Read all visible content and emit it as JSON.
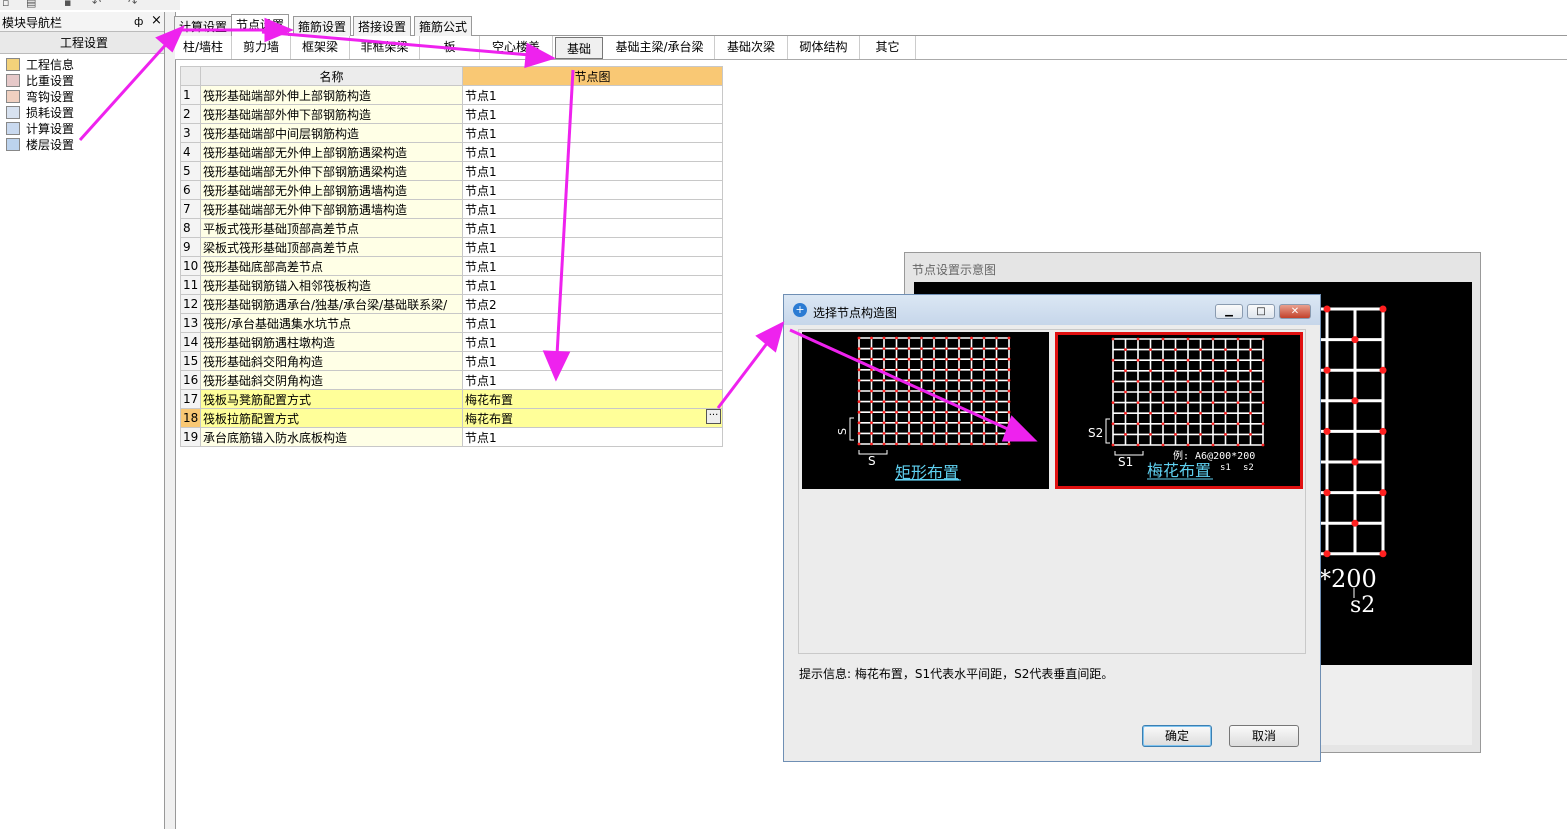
{
  "nav": {
    "title": "模块导航栏",
    "pin_glyph": "ф",
    "close_glyph": "×",
    "header": "工程设置",
    "items": [
      {
        "label": "工程信息",
        "icon": "project-info-icon"
      },
      {
        "label": "比重设置",
        "icon": "density-icon"
      },
      {
        "label": "弯钩设置",
        "icon": "hook-icon"
      },
      {
        "label": "损耗设置",
        "icon": "loss-icon"
      },
      {
        "label": "计算设置",
        "icon": "calc-icon"
      },
      {
        "label": "楼层设置",
        "icon": "floor-icon"
      }
    ]
  },
  "tabs": [
    "计算设置",
    "节点设置",
    "箍筋设置",
    "搭接设置",
    "箍筋公式"
  ],
  "subtabs": [
    "柱/墙柱",
    "剪力墙",
    "框架梁",
    "非框架梁",
    "板",
    "空心楼盖",
    "基础",
    "基础主梁/承台梁",
    "基础次梁",
    "砌体结构",
    "其它"
  ],
  "table": {
    "headers": [
      "名称",
      "节点图"
    ],
    "rows": [
      {
        "n": "1",
        "name": "筏形基础端部外伸上部钢筋构造",
        "value": "节点1"
      },
      {
        "n": "2",
        "name": "筏形基础端部外伸下部钢筋构造",
        "value": "节点1"
      },
      {
        "n": "3",
        "name": "筏形基础端部中间层钢筋构造",
        "value": "节点1"
      },
      {
        "n": "4",
        "name": "筏形基础端部无外伸上部钢筋遇梁构造",
        "value": "节点1"
      },
      {
        "n": "5",
        "name": "筏形基础端部无外伸下部钢筋遇梁构造",
        "value": "节点1"
      },
      {
        "n": "6",
        "name": "筏形基础端部无外伸上部钢筋遇墙构造",
        "value": "节点1"
      },
      {
        "n": "7",
        "name": "筏形基础端部无外伸下部钢筋遇墙构造",
        "value": "节点1"
      },
      {
        "n": "8",
        "name": "平板式筏形基础顶部高差节点",
        "value": "节点1"
      },
      {
        "n": "9",
        "name": "梁板式筏形基础顶部高差节点",
        "value": "节点1"
      },
      {
        "n": "10",
        "name": "筏形基础底部高差节点",
        "value": "节点1"
      },
      {
        "n": "11",
        "name": "筏形基础钢筋锚入相邻筏板构造",
        "value": "节点1"
      },
      {
        "n": "12",
        "name": "筏形基础钢筋遇承台/独基/承台梁/基础联系梁/",
        "value": "节点2"
      },
      {
        "n": "13",
        "name": "筏形/承台基础遇集水坑节点",
        "value": "节点1"
      },
      {
        "n": "14",
        "name": "筏形基础钢筋遇柱墩构造",
        "value": "节点1"
      },
      {
        "n": "15",
        "name": "筏形基础斜交阳角构造",
        "value": "节点1"
      },
      {
        "n": "16",
        "name": "筏形基础斜交阴角构造",
        "value": "节点1"
      },
      {
        "n": "17",
        "name": "筏板马凳筋配置方式",
        "value": "梅花布置"
      },
      {
        "n": "18",
        "name": "筏板拉筋配置方式",
        "value": "梅花布置"
      },
      {
        "n": "19",
        "name": "承台底筋锚入防水底板构造",
        "value": "节点1"
      }
    ],
    "ellipsis": "···"
  },
  "preview_window": {
    "title": "节点设置示意图",
    "text1": "*200",
    "text2": "s2"
  },
  "dialog": {
    "title": "选择节点构造图",
    "option1": {
      "label": "矩形布置",
      "s_vert": "S",
      "s_horiz": "S"
    },
    "option2": {
      "label": "梅花布置",
      "s_vert": "S2",
      "s_horiz": "S1",
      "example": "例: A6@200*200",
      "sub1": "s1",
      "sub2": "s2"
    },
    "hint": "提示信息: 梅花布置，S1代表水平间距，S2代表垂直间距。",
    "ok": "确定",
    "cancel": "取消",
    "min_glyph": "▁",
    "max_glyph": "□",
    "close_glyph": "✕",
    "icon_glyph": "+"
  },
  "colors": {
    "arrow": "#ee22ee",
    "selected_border": "#e01010",
    "grid_line": "#ffffff",
    "grid_dot": "#ff2020",
    "header_highlight": "#f9c874"
  }
}
